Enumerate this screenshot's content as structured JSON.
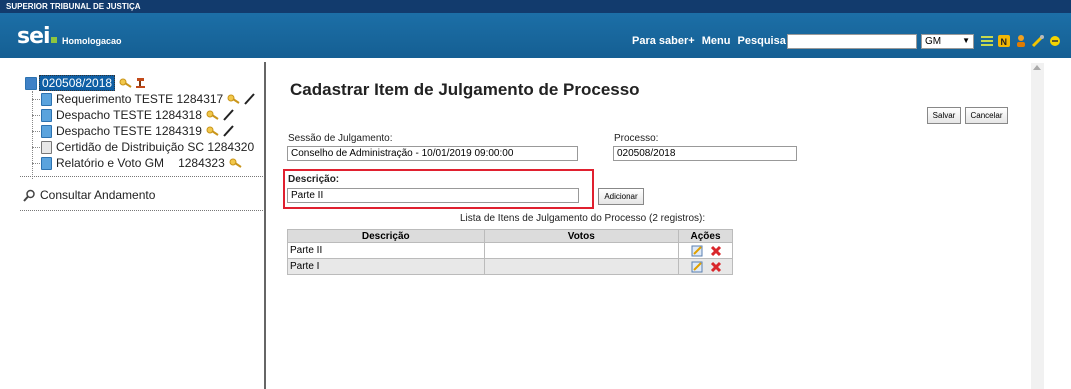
{
  "header": {
    "org": "SUPERIOR TRIBUNAL DE JUSTIÇA",
    "logo": "sei",
    "environment": "Homologacao",
    "links": [
      "Para saber+",
      "Menu",
      "Pesquisa"
    ],
    "search_value": "",
    "unit": "GM",
    "icons": [
      "list-icon",
      "notes-icon",
      "user-icon",
      "tools-icon",
      "exit-icon"
    ]
  },
  "tree": {
    "process": "020508/2018",
    "documents": [
      {
        "label": "Requerimento TESTE 1284317",
        "type": "doc",
        "key": true,
        "pen": true
      },
      {
        "label": "Despacho TESTE 1284318",
        "type": "doc",
        "key": true,
        "pen": true
      },
      {
        "label": "Despacho TESTE 1284319",
        "type": "doc",
        "key": true,
        "pen": true
      },
      {
        "label": "Certidão de Distribuição SC 1284320",
        "type": "cert",
        "key": false,
        "pen": false
      },
      {
        "label": "Relatório e Voto GM",
        "number": "1284323",
        "type": "doc",
        "key": true,
        "pen": false
      }
    ],
    "consultar": "Consultar Andamento"
  },
  "form": {
    "title": "Cadastrar Item de Julgamento de Processo",
    "save": "Salvar",
    "cancel": "Cancelar",
    "sessao_label": "Sessão de Julgamento:",
    "sessao_value": "Conselho de Administração - 10/01/2019 09:00:00",
    "processo_label": "Processo:",
    "processo_value": "020508/2018",
    "descricao_label": "Descrição:",
    "descricao_value": "Parte II",
    "add": "Adicionar",
    "list_caption": "Lista de Itens de Julgamento do Processo (2 registros):",
    "columns": [
      "Descrição",
      "Votos",
      "Ações"
    ],
    "rows": [
      {
        "descricao": "Parte II",
        "votos": ""
      },
      {
        "descricao": "Parte I",
        "votos": ""
      }
    ]
  },
  "colors": {
    "header": "#1c6fa7",
    "topbar": "#123b6d",
    "highlight": "#e0202f",
    "brand_green": "#8ec63f"
  }
}
